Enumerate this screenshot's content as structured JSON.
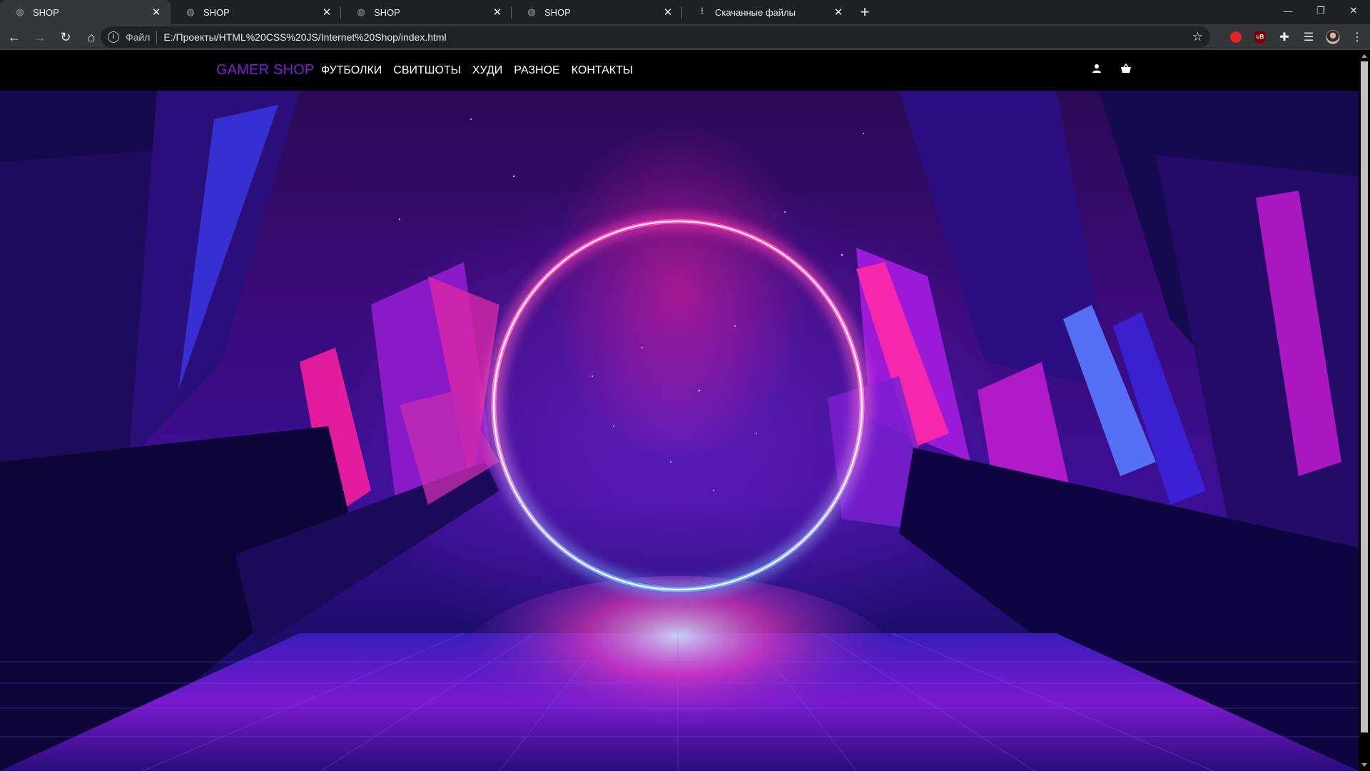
{
  "browser": {
    "tabs": [
      {
        "title": "SHOP",
        "icon": "globe-icon",
        "active": true
      },
      {
        "title": "SHOP",
        "icon": "globe-icon",
        "active": false
      },
      {
        "title": "SHOP",
        "icon": "globe-icon",
        "active": false
      },
      {
        "title": "SHOP",
        "icon": "globe-icon",
        "active": false
      },
      {
        "title": "Скачанные файлы",
        "icon": "download-icon",
        "active": false
      }
    ],
    "address": {
      "scheme_label": "Файл",
      "url": "E:/Проекты/HTML%20CSS%20JS/Internet%20Shop/index.html"
    },
    "extension_badge": "uB"
  },
  "site": {
    "logo": "GAMER SHOP",
    "menu": [
      "ФУТБОЛКИ",
      "СВИТШОТЫ",
      "ХУДИ",
      "РАЗНОЕ",
      "КОНТАКТЫ"
    ],
    "header_icons": [
      "user-icon",
      "cart-icon"
    ]
  },
  "colors": {
    "logo": "#7a1fd6",
    "ring_glow": "#ff2fb0",
    "ring_core": "#ffffff",
    "hero_dark": "#1c0d6a"
  }
}
